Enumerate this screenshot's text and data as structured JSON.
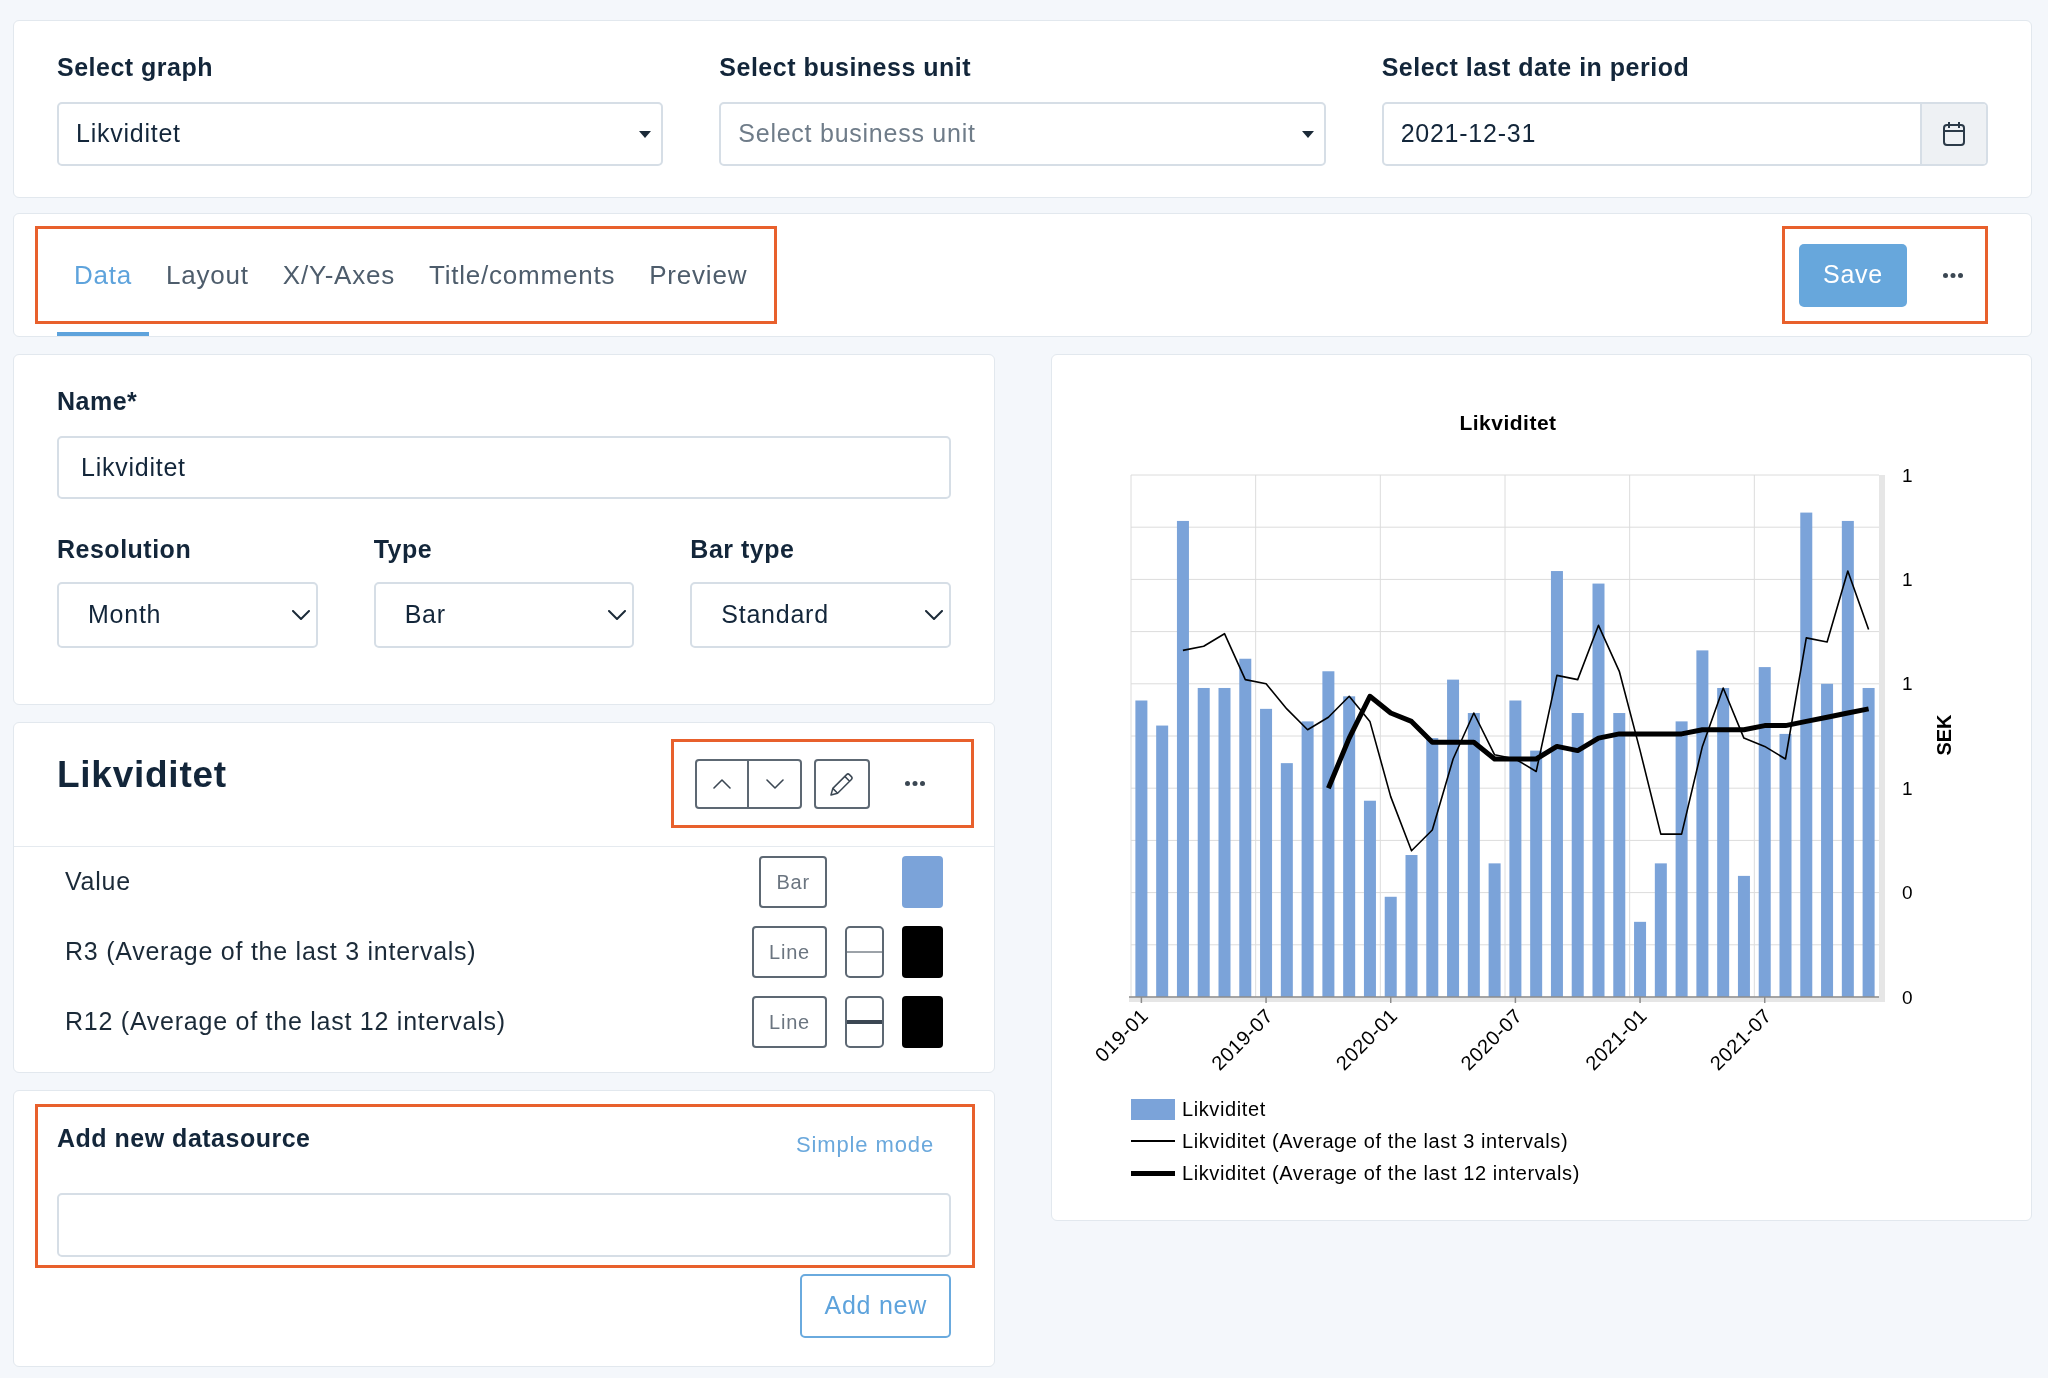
{
  "filters": [
    {
      "kind": "select",
      "label": "Select graph",
      "value": "Likviditet"
    },
    {
      "kind": "select",
      "label": "Select business unit",
      "placeholder": "Select business unit"
    },
    {
      "kind": "date",
      "label": "Select last date in period",
      "value": "2021-12-31"
    }
  ],
  "editor_bar": {
    "tabs": [
      {
        "label": "Data",
        "selected": true
      },
      {
        "label": "Layout",
        "selected": false
      },
      {
        "label": "X/Y-Axes",
        "selected": false
      },
      {
        "label": "Title/comments",
        "selected": false
      },
      {
        "label": "Preview",
        "selected": false
      }
    ],
    "tabs_highlighted": true,
    "save_button": "Save",
    "actions_highlighted": true
  },
  "settings": {
    "name_label": "Name*",
    "name_value": "Likviditet",
    "fields": [
      {
        "label": "Resolution",
        "value": "Month"
      },
      {
        "label": "Type",
        "value": "Bar"
      },
      {
        "label": "Bar type",
        "value": "Standard"
      }
    ]
  },
  "datasource": {
    "title": "Likviditet",
    "toolbar_highlighted": true,
    "rows": [
      {
        "kind": "bar",
        "label": "Value",
        "type_button": "Bar",
        "color": "#7ba3d9"
      },
      {
        "kind": "line",
        "label": "R3 (Average of the last 3 intervals)",
        "type_button": "Line",
        "thick": false,
        "color": "#000000"
      },
      {
        "kind": "line",
        "label": "R12 (Average of the last 12 intervals)",
        "type_button": "Line",
        "thick": true,
        "color": "#000000"
      }
    ]
  },
  "add_datasource": {
    "title": "Add new datasource",
    "link": "Simple mode",
    "highlighted": true,
    "button": "Add new"
  },
  "chart": {
    "chart_data": {
      "type": "bar",
      "title": "Likviditet",
      "ylabel": "SEK",
      "grid": true,
      "legend": "bottom",
      "categories": [
        "019-01",
        null,
        null,
        null,
        null,
        null,
        "2019-07",
        null,
        null,
        null,
        null,
        null,
        "2020-01",
        null,
        null,
        null,
        null,
        null,
        "2020-07",
        null,
        null,
        null,
        null,
        null,
        "2021-01",
        null,
        null,
        null,
        null,
        null,
        "2021-07",
        null,
        null,
        null,
        null,
        null
      ],
      "ylim": [
        0,
        1.25
      ],
      "yticks": [
        {
          "value": 0,
          "label": "0"
        },
        {
          "value": 0.25,
          "label": "0"
        },
        {
          "value": 0.5,
          "label": "1"
        },
        {
          "value": 0.75,
          "label": "1"
        },
        {
          "value": 1,
          "label": "1"
        },
        {
          "value": 1.25,
          "label": "1"
        }
      ],
      "series": [
        {
          "name": "Likviditet",
          "type": "bar",
          "color": "#7ba3d9",
          "values": [
            0.71,
            0.65,
            1.14,
            0.74,
            0.74,
            0.81,
            0.69,
            0.56,
            0.66,
            0.78,
            0.72,
            0.47,
            0.24,
            0.34,
            0.62,
            0.76,
            0.68,
            0.32,
            0.71,
            0.59,
            1.02,
            0.68,
            0.99,
            0.68,
            0.18,
            0.32,
            0.66,
            0.83,
            0.74,
            0.29,
            0.79,
            0.63,
            1.16,
            0.75,
            1.14,
            0.74
          ]
        },
        {
          "name": "Likviditet (Average of the last 3 intervals)",
          "type": "line",
          "line_style": "solid",
          "color": "#000000",
          "values": [
            null,
            null,
            0.83,
            0.84,
            0.87,
            0.76,
            0.75,
            0.69,
            0.64,
            0.67,
            0.72,
            0.66,
            0.48,
            0.35,
            0.4,
            0.57,
            0.68,
            0.58,
            0.57,
            0.54,
            0.77,
            0.76,
            0.89,
            0.78,
            0.59,
            0.39,
            0.39,
            0.6,
            0.74,
            0.62,
            0.6,
            0.57,
            0.86,
            0.85,
            1.02,
            0.88
          ]
        },
        {
          "name": "Likviditet (Average of the last 12 intervals)",
          "type": "line",
          "line_style": "solid",
          "color": "#000000",
          "values": [
            null,
            null,
            null,
            null,
            null,
            null,
            null,
            null,
            null,
            0.5,
            0.62,
            0.72,
            0.68,
            0.66,
            0.61,
            0.61,
            0.61,
            0.57,
            0.57,
            0.57,
            0.6,
            0.59,
            0.62,
            0.63,
            0.63,
            0.63,
            0.63,
            0.64,
            0.64,
            0.64,
            0.65,
            0.65,
            0.66,
            0.67,
            0.68,
            0.69
          ]
        }
      ]
    }
  }
}
